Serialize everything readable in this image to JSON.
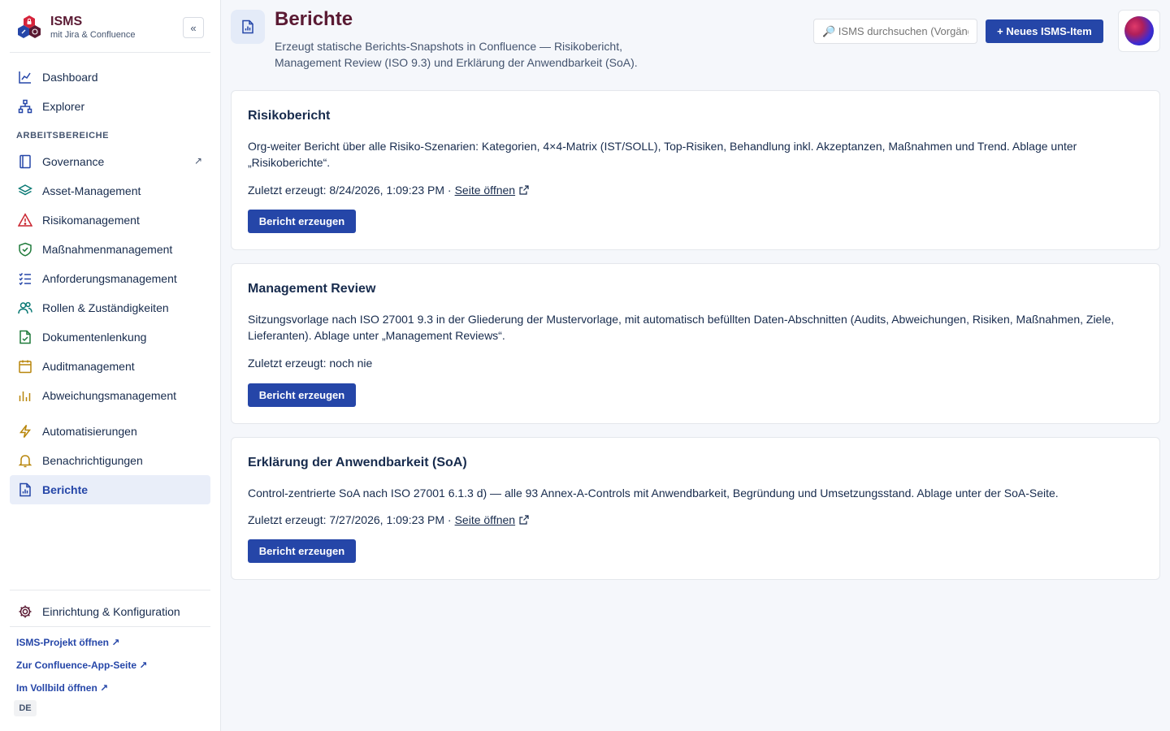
{
  "brand": {
    "title": "ISMS",
    "subtitle": "mit Jira & Confluence",
    "collapse_label": "«"
  },
  "nav_top": [
    {
      "label": "Dashboard",
      "icon": "chart-line-icon"
    },
    {
      "label": "Explorer",
      "icon": "hierarchy-icon"
    }
  ],
  "section_label": "ARBEITSBEREICHE",
  "nav_workspaces": [
    {
      "label": "Governance",
      "icon": "book-icon",
      "external": "↗"
    },
    {
      "label": "Asset-Management",
      "icon": "layers-icon"
    },
    {
      "label": "Risikomanagement",
      "icon": "warning-icon"
    },
    {
      "label": "Maßnahmenmanagement",
      "icon": "shield-check-icon"
    },
    {
      "label": "Anforderungsmanagement",
      "icon": "checklist-icon"
    },
    {
      "label": "Rollen & Zuständigkeiten",
      "icon": "users-icon"
    },
    {
      "label": "Dokumentenlenkung",
      "icon": "document-check-icon"
    },
    {
      "label": "Auditmanagement",
      "icon": "calendar-icon"
    },
    {
      "label": "Abweichungsmanagement",
      "icon": "bar-chart-icon"
    }
  ],
  "nav_tools": [
    {
      "label": "Automatisierungen",
      "icon": "lightning-icon"
    },
    {
      "label": "Benachrichtigungen",
      "icon": "bell-icon"
    },
    {
      "label": "Berichte",
      "icon": "report-icon",
      "active": true
    }
  ],
  "nav_settings": {
    "label": "Einrichtung & Konfiguration",
    "icon": "gear-icon"
  },
  "footer_links": [
    "ISMS-Projekt öffnen ↗",
    "Zur Confluence-App-Seite ↗",
    "Im Vollbild öffnen ↗"
  ],
  "language": "DE",
  "header": {
    "title": "Berichte",
    "description": "Erzeugt statische Berichts-Snapshots in Confluence — Risikobericht, Management Review (ISO 9.3) und Erklärung der Anwendbarkeit (SoA).",
    "search_placeholder": "🔎 ISMS durchsuchen (Vorgänge, Seiten …)",
    "new_item_label": "+ Neues ISMS-Item"
  },
  "colors": {
    "accent": "#2546a8",
    "title": "#5a1a33",
    "active_bg": "#e9eef9"
  },
  "reports": [
    {
      "title": "Risikobericht",
      "description": "Org-weiter Bericht über alle Risiko-Szenarien: Kategorien, 4×4-Matrix (IST/SOLL), Top-Risiken, Behandlung inkl. Akzeptanzen, Maßnahmen und Trend. Ablage unter „Risikoberichte“.",
      "last_generated": "Zuletzt erzeugt: 8/24/2026, 1:09:23 PM ·",
      "link_label": "Seite öffnen",
      "button_label": "Bericht erzeugen"
    },
    {
      "title": "Management Review",
      "description": "Sitzungsvorlage nach ISO 27001 9.3 in der Gliederung der Mustervorlage, mit automatisch befüllten Daten-Abschnitten (Audits, Abweichungen, Risiken, Maßnahmen, Ziele, Lieferanten). Ablage unter „Management Reviews“.",
      "last_generated": "Zuletzt erzeugt: noch nie",
      "button_label": "Bericht erzeugen"
    },
    {
      "title": "Erklärung der Anwendbarkeit (SoA)",
      "description": "Control-zentrierte SoA nach ISO 27001 6.1.3 d) — alle 93 Annex-A-Controls mit Anwendbarkeit, Begründung und Umsetzungsstand. Ablage unter der SoA-Seite.",
      "last_generated": "Zuletzt erzeugt: 7/27/2026, 1:09:23 PM ·",
      "link_label": "Seite öffnen",
      "button_label": "Bericht erzeugen"
    }
  ]
}
